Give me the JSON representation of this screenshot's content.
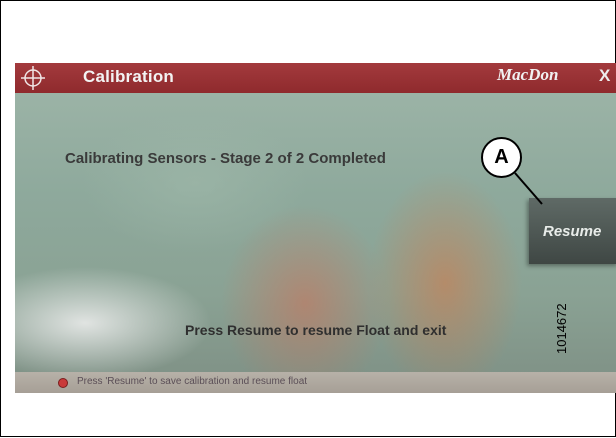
{
  "window": {
    "title": "Calibration",
    "brand": "MacDon",
    "close_glyph": "X"
  },
  "main": {
    "status_line": "Calibrating Sensors - Stage 2 of 2 Completed",
    "resume_label": "Resume",
    "instruction": "Press Resume to resume Float and exit"
  },
  "status_bar": {
    "message": "Press 'Resume' to save calibration and resume float"
  },
  "callout": {
    "label": "A"
  },
  "figure": {
    "id": "1014672"
  },
  "icons": {
    "title_icon": "crosshair-icon",
    "status_icon": "alert-dot-icon"
  }
}
